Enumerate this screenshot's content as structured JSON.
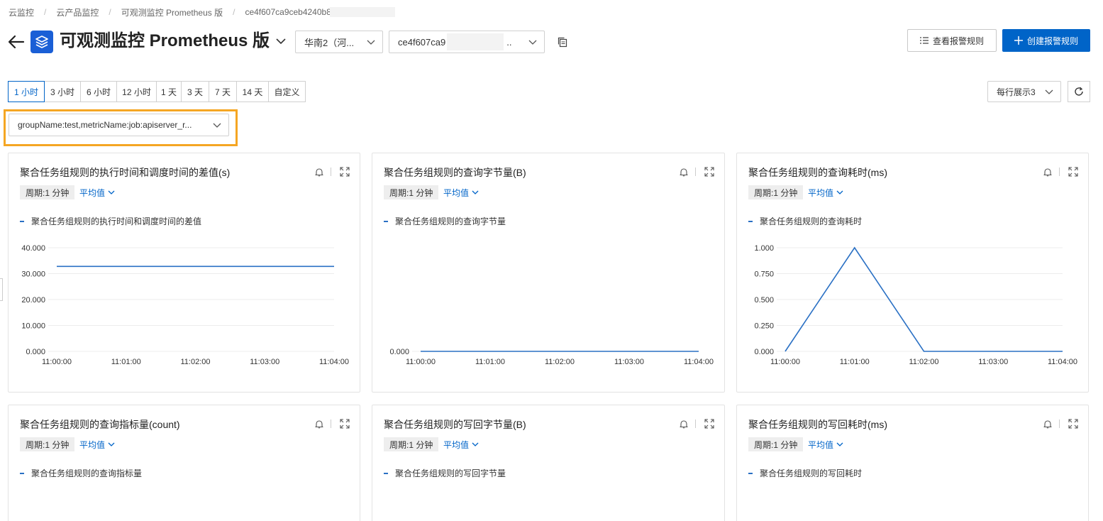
{
  "breadcrumb": {
    "items": [
      "云监控",
      "云产品监控",
      "可观测监控 Prometheus 版",
      "ce4f607ca9ceb4240b8"
    ]
  },
  "header": {
    "title": "可观测监控 Prometheus 版",
    "region": "华南2（河...",
    "instance_prefix": "ce4f607ca9",
    "instance_suffix": "..",
    "view_rules_label": "查看报警规则",
    "create_rule_label": "创建报警规则"
  },
  "time_range": {
    "options": [
      "1 小时",
      "3 小时",
      "6 小时",
      "12 小时",
      "1 天",
      "3 天",
      "7 天",
      "14 天",
      "自定义"
    ],
    "selected": "1 小时"
  },
  "per_row": "每行展示3",
  "filter": {
    "value": "groupName:test,metricName:job:apiserver_r..."
  },
  "colors": {
    "brand": "#0064c8",
    "series": "#2a70c4",
    "highlight": "#f5a623"
  },
  "cards": [
    {
      "title": "聚合任务组规则的执行时间和调度时间的差值(s)",
      "period": "周期:1 分钟",
      "agg": "平均值",
      "legend": "聚合任务组规则的执行时间和调度时间的差值"
    },
    {
      "title": "聚合任务组规则的查询字节量(B)",
      "period": "周期:1 分钟",
      "agg": "平均值",
      "legend": "聚合任务组规则的查询字节量"
    },
    {
      "title": "聚合任务组规则的查询耗时(ms)",
      "period": "周期:1 分钟",
      "agg": "平均值",
      "legend": "聚合任务组规则的查询耗时"
    },
    {
      "title": "聚合任务组规则的查询指标量(count)",
      "period": "周期:1 分钟",
      "agg": "平均值",
      "legend": "聚合任务组规则的查询指标量"
    },
    {
      "title": "聚合任务组规则的写回字节量(B)",
      "period": "周期:1 分钟",
      "agg": "平均值",
      "legend": "聚合任务组规则的写回字节量"
    },
    {
      "title": "聚合任务组规则的写回耗时(ms)",
      "period": "周期:1 分钟",
      "agg": "平均值",
      "legend": "聚合任务组规则的写回耗时"
    }
  ],
  "chart_data": [
    {
      "type": "line",
      "categories": [
        "11:00:00",
        "11:01:00",
        "11:02:00",
        "11:03:00",
        "11:04:00"
      ],
      "yticks": [
        "0.000",
        "10.000",
        "20.000",
        "30.000",
        "40.000"
      ],
      "ylim": [
        0,
        40
      ],
      "grid": true,
      "legend": "top-left",
      "series": [
        {
          "name": "聚合任务组规则的执行时间和调度时间的差值",
          "values": [
            32.8,
            32.8,
            32.8,
            32.8,
            32.8
          ]
        }
      ]
    },
    {
      "type": "line",
      "categories": [
        "11:00:00",
        "11:01:00",
        "11:02:00",
        "11:03:00",
        "11:04:00"
      ],
      "yticks": [
        "0.000"
      ],
      "ylim": [
        0,
        1
      ],
      "grid": true,
      "legend": "top-left",
      "series": [
        {
          "name": "聚合任务组规则的查询字节量",
          "values": [
            0,
            0,
            0,
            0,
            0
          ]
        }
      ]
    },
    {
      "type": "line",
      "categories": [
        "11:00:00",
        "11:01:00",
        "11:02:00",
        "11:03:00",
        "11:04:00"
      ],
      "yticks": [
        "0.000",
        "0.250",
        "0.500",
        "0.750",
        "1.000"
      ],
      "ylim": [
        0,
        1
      ],
      "grid": true,
      "legend": "top-left",
      "series": [
        {
          "name": "聚合任务组规则的查询耗时",
          "values": [
            0,
            1,
            0,
            0,
            0
          ]
        }
      ]
    }
  ]
}
